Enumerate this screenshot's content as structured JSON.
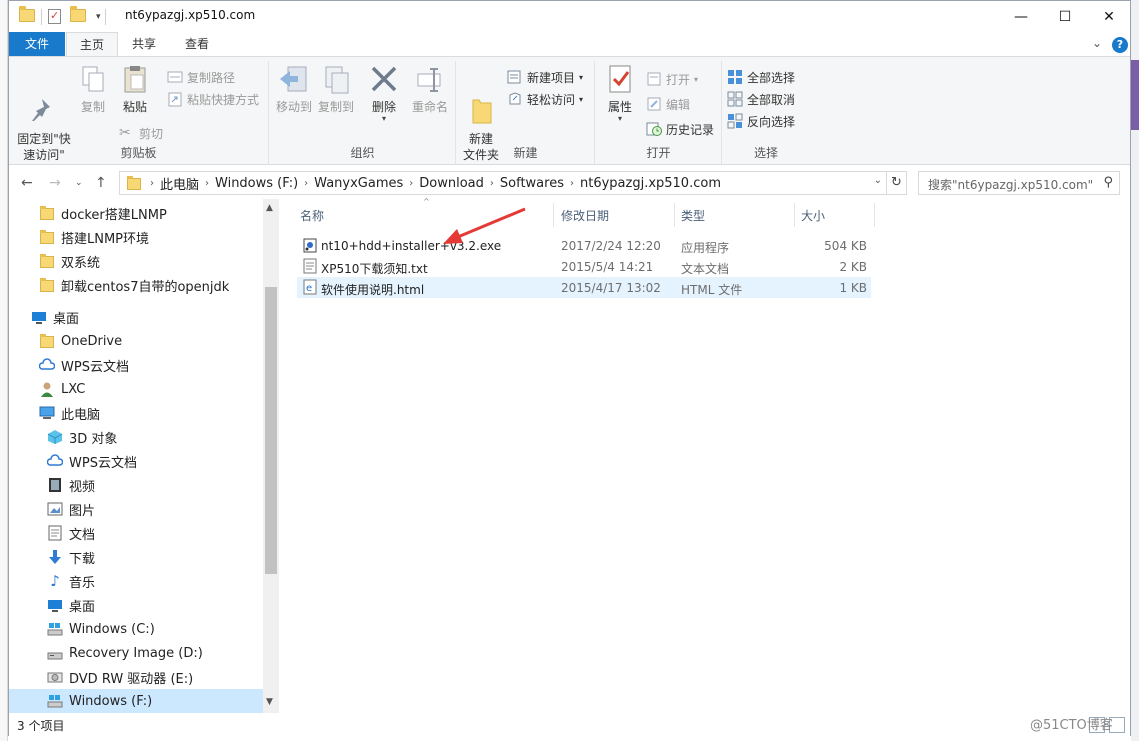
{
  "window": {
    "title": "nt6ypazgj.xp510.com",
    "minimize_glyph": "—",
    "maximize_glyph": "☐",
    "close_glyph": "✕"
  },
  "ribbon_tabs": {
    "file": "文件",
    "home": "主页",
    "share": "共享",
    "view": "查看",
    "help_glyph": "?",
    "collapse_glyph": "⌄"
  },
  "ribbon": {
    "clipboard": {
      "label": "剪贴板",
      "pin_quick_access": "固定到\"快\n速访问\"",
      "copy": "复制",
      "paste": "粘贴",
      "copy_path": "复制路径",
      "paste_shortcut": "粘贴快捷方式",
      "cut": "剪切"
    },
    "organize": {
      "label": "组织",
      "move_to": "移动到",
      "copy_to": "复制到",
      "delete": "删除",
      "rename": "重命名"
    },
    "new": {
      "label": "新建",
      "new_folder": "新建\n文件夹",
      "new_item": "新建项目",
      "easy_access": "轻松访问"
    },
    "open": {
      "label": "打开",
      "properties": "属性",
      "open": "打开",
      "edit": "编辑",
      "history": "历史记录"
    },
    "select": {
      "label": "选择",
      "select_all": "全部选择",
      "select_none": "全部取消",
      "invert": "反向选择"
    }
  },
  "address": {
    "crumbs": [
      "此电脑",
      "Windows (F:)",
      "WanyxGames",
      "Download",
      "Softwares",
      "nt6ypazgj.xp510.com"
    ],
    "search_placeholder": "搜索\"nt6ypazgj.xp510.com\""
  },
  "nav_pane": {
    "items": [
      {
        "label": "docker搭建LNMP",
        "icon": "folder-icon"
      },
      {
        "label": "搭建LNMP环境",
        "icon": "folder-icon"
      },
      {
        "label": "双系统",
        "icon": "folder-icon"
      },
      {
        "label": "卸载centos7自带的openjdk",
        "icon": "folder-icon"
      },
      {
        "label": "桌面",
        "icon": "desktop-icon"
      },
      {
        "label": "OneDrive",
        "icon": "folder-icon"
      },
      {
        "label": "WPS云文档",
        "icon": "cloud-icon"
      },
      {
        "label": "LXC",
        "icon": "user-icon"
      },
      {
        "label": "此电脑",
        "icon": "computer-icon"
      },
      {
        "label": "3D 对象",
        "icon": "cube-icon"
      },
      {
        "label": "WPS云文档",
        "icon": "cloud-icon"
      },
      {
        "label": "视频",
        "icon": "video-icon"
      },
      {
        "label": "图片",
        "icon": "picture-icon"
      },
      {
        "label": "文档",
        "icon": "document-icon"
      },
      {
        "label": "下载",
        "icon": "download-icon"
      },
      {
        "label": "音乐",
        "icon": "music-icon"
      },
      {
        "label": "桌面",
        "icon": "desktop-icon"
      },
      {
        "label": "Windows (C:)",
        "icon": "drive-icon"
      },
      {
        "label": "Recovery Image (D:)",
        "icon": "drive-icon"
      },
      {
        "label": "DVD RW 驱动器 (E:)",
        "icon": "dvd-icon"
      },
      {
        "label": "Windows (F:)",
        "icon": "drive-icon"
      }
    ]
  },
  "file_list": {
    "columns": {
      "name": "名称",
      "date": "修改日期",
      "type": "类型",
      "size": "大小"
    },
    "rows": [
      {
        "name": "nt10+hdd+installer+v3.2.exe",
        "date": "2017/2/24 12:20",
        "type": "应用程序",
        "size": "504 KB",
        "icon": "exe-icon"
      },
      {
        "name": "XP510下载须知.txt",
        "date": "2015/5/4 14:21",
        "type": "文本文档",
        "size": "2 KB",
        "icon": "txt-icon"
      },
      {
        "name": "软件使用说明.html",
        "date": "2015/4/17 13:02",
        "type": "HTML 文件",
        "size": "1 KB",
        "icon": "html-icon"
      }
    ]
  },
  "status": {
    "count": "3 个项目"
  },
  "watermark": "@51CTO博客",
  "colors": {
    "accent": "#1979ca",
    "selection": "#cce8ff",
    "hover": "#e5f3ff",
    "annotation": "#e53935"
  }
}
